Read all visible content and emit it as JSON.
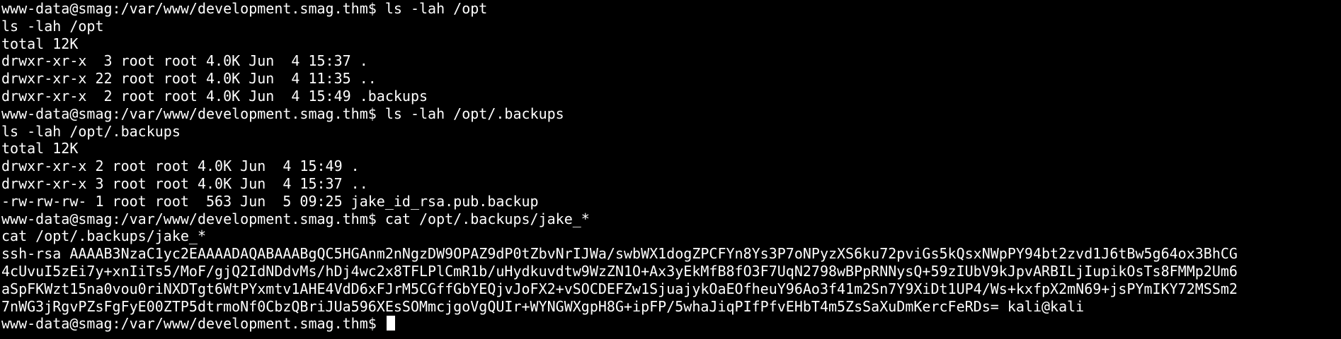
{
  "terminal": {
    "lines": [
      "www-data@smag:/var/www/development.smag.thm$ ls -lah /opt",
      "ls -lah /opt",
      "total 12K",
      "drwxr-xr-x  3 root root 4.0K Jun  4 15:37 .",
      "drwxr-xr-x 22 root root 4.0K Jun  4 11:35 ..",
      "drwxr-xr-x  2 root root 4.0K Jun  4 15:49 .backups",
      "www-data@smag:/var/www/development.smag.thm$ ls -lah /opt/.backups",
      "ls -lah /opt/.backups",
      "total 12K",
      "drwxr-xr-x 2 root root 4.0K Jun  4 15:49 .",
      "drwxr-xr-x 3 root root 4.0K Jun  4 15:37 ..",
      "-rw-rw-rw- 1 root root  563 Jun  5 09:25 jake_id_rsa.pub.backup",
      "www-data@smag:/var/www/development.smag.thm$ cat /opt/.backups/jake_*",
      "cat /opt/.backups/jake_*",
      "ssh-rsa AAAAB3NzaC1yc2EAAAADAQABAAABgQC5HGAnm2nNgzDW9OPAZ9dP0tZbvNrIJWa/swbWX1dogZPCFYn8Ys3P7oNPyzXS6ku72pviGs5kQsxNWpPY94bt2zvd1J6tBw5g64ox3BhCG",
      "4cUvuI5zEi7y+xnIiTs5/MoF/gjQ2IdNDdvMs/hDj4wc2x8TFLPlCmR1b/uHydkuvdtw9WzZN1O+Ax3yEkMfB8fO3F7UqN2798wBPpRNNysQ+59zIUbV9kJpvARBILjIupikOsTs8FMMp2Um6",
      "aSpFKWzt15na0vou0riNXDTgt6WtPYxmtv1AHE4VdD6xFJrM5CGffGbYEQjvJoFX2+vSOCDEFZw1SjuajykOaEOfheuY96Ao3f41m2Sn7Y9XiDt1UP4/Ws+kxfpX2mN69+jsPYmIKY72MSSm2",
      "7nWG3jRgvPZsFgFyE00ZTP5dtrmoNf0CbzQBriJUa596XEsSOMmcjgoVgQUIr+WYNGWXgpH8G+ipFP/5whaJiqPIfPfvEHbT4m5ZsSaXuDmKercFeRDs= kali@kali"
    ],
    "prompt": "www-data@smag:/var/www/development.smag.thm$ "
  }
}
